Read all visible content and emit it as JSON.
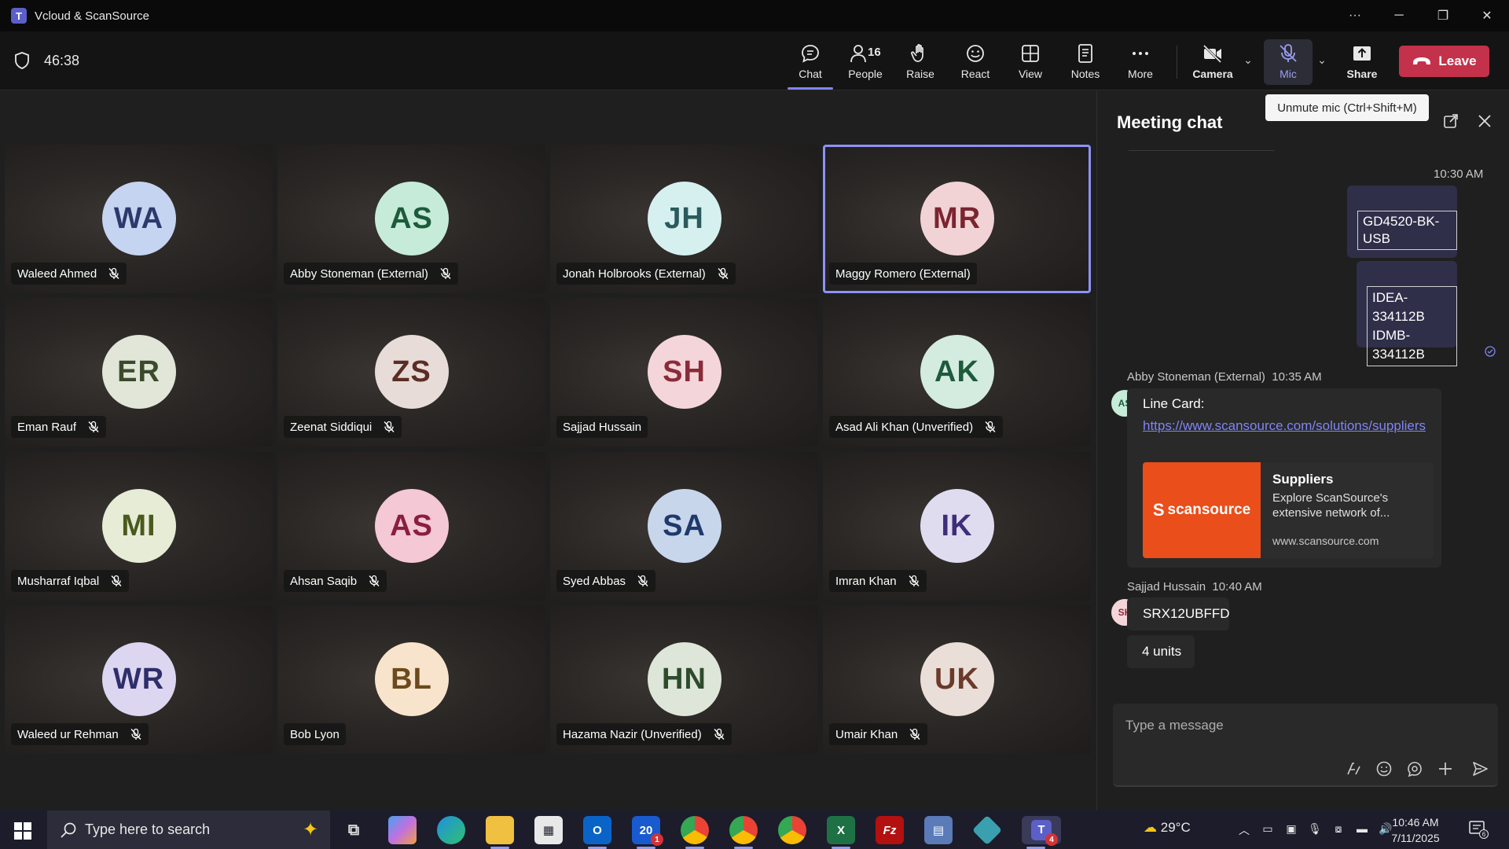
{
  "window": {
    "title": "Vcloud & ScanSource",
    "app_icon": "teams-icon"
  },
  "meeting": {
    "timer": "46:38"
  },
  "toolbar": {
    "chat": "Chat",
    "people": "People",
    "people_count": "16",
    "raise": "Raise",
    "react": "React",
    "view": "View",
    "notes": "Notes",
    "more": "More",
    "camera": "Camera",
    "mic": "Mic",
    "share": "Share",
    "leave": "Leave"
  },
  "tooltip": "Unmute mic (Ctrl+Shift+M)",
  "participants": [
    {
      "initials": "WA",
      "name": "Waleed Ahmed",
      "muted": true,
      "bg": "#c5d4f0",
      "fg": "#2b3a6b"
    },
    {
      "initials": "AS",
      "name": "Abby Stoneman (External)",
      "muted": true,
      "bg": "#c6ecd9",
      "fg": "#1e5a3c"
    },
    {
      "initials": "JH",
      "name": "Jonah Holbrooks (External)",
      "muted": true,
      "bg": "#d6f0f0",
      "fg": "#2a5a5c"
    },
    {
      "initials": "MR",
      "name": "Maggy Romero (External)",
      "muted": false,
      "bg": "#f2d3d5",
      "fg": "#7a2530"
    },
    {
      "initials": "ER",
      "name": "Eman Rauf",
      "muted": true,
      "bg": "#e1e6d8",
      "fg": "#3b4a2c"
    },
    {
      "initials": "ZS",
      "name": "Zeenat Siddiqui",
      "muted": true,
      "bg": "#e8dcd8",
      "fg": "#5a2e24"
    },
    {
      "initials": "SH",
      "name": "Sajjad Hussain",
      "muted": false,
      "bg": "#f4d6da",
      "fg": "#8a2b3a"
    },
    {
      "initials": "AK",
      "name": "Asad Ali Khan (Unverified)",
      "muted": true,
      "bg": "#d4ece0",
      "fg": "#1e5a3c"
    },
    {
      "initials": "MI",
      "name": "Musharraf Iqbal",
      "muted": true,
      "bg": "#e6ecd6",
      "fg": "#4a5a1e"
    },
    {
      "initials": "AS",
      "name": "Ahsan Saqib",
      "muted": true,
      "bg": "#f4c8d4",
      "fg": "#8a1e3e"
    },
    {
      "initials": "SA",
      "name": "Syed Abbas",
      "muted": true,
      "bg": "#c8d6ec",
      "fg": "#1e3a6b"
    },
    {
      "initials": "IK",
      "name": "Imran Khan",
      "muted": true,
      "bg": "#e0dcf0",
      "fg": "#3e2e7a"
    },
    {
      "initials": "WR",
      "name": "Waleed ur Rehman",
      "muted": true,
      "bg": "#dcd6f0",
      "fg": "#2e2e6b"
    },
    {
      "initials": "BL",
      "name": "Bob Lyon",
      "muted": false,
      "bg": "#f8e4cc",
      "fg": "#6b4a1e"
    },
    {
      "initials": "HN",
      "name": "Hazama Nazir (Unverified)",
      "muted": true,
      "bg": "#dde6d8",
      "fg": "#2e4a2c"
    },
    {
      "initials": "UK",
      "name": "Umair Khan",
      "muted": true,
      "bg": "#eadfd8",
      "fg": "#6b3a2a"
    }
  ],
  "chat": {
    "title": "Meeting chat",
    "my_time": "10:30 AM",
    "my_codes": [
      "GD4520-BK-USB",
      "IDEA-334112B",
      "IDMB-334112B"
    ],
    "msg1": {
      "sender": "Abby Stoneman (External)",
      "time": "10:35 AM",
      "avatar": "AS",
      "text": "Line Card:",
      "link": "https://www.scansource.com/solutions/suppliers",
      "preview_brand": "scansource",
      "preview_title": "Suppliers",
      "preview_desc": "Explore ScanSource's extensive network of...",
      "preview_url": "www.scansource.com"
    },
    "msg2": {
      "sender": "Sajjad Hussain",
      "time": "10:40 AM",
      "avatar": "SH",
      "line1": "SRX12UBFFD",
      "line2": "4 units"
    },
    "compose_placeholder": "Type a message"
  },
  "taskbar": {
    "search_placeholder": "Type here to search",
    "weather": "29°C",
    "time": "10:46 AM",
    "date": "7/11/2025",
    "notification_count": "6",
    "teams_badge": "4",
    "outlook_badge": "1"
  }
}
